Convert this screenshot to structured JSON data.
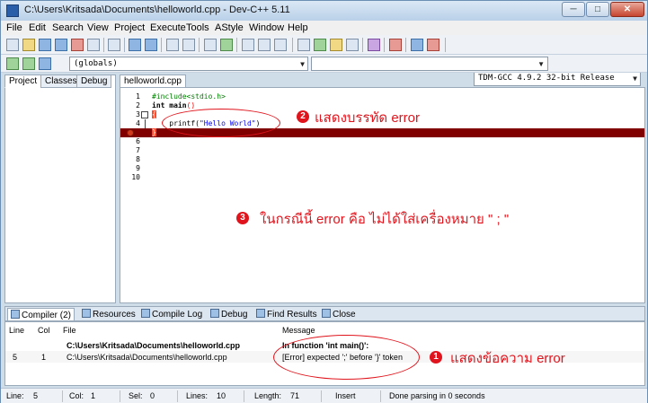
{
  "window": {
    "title": "C:\\Users\\Kritsada\\Documents\\helloworld.cpp - Dev-C++ 5.11",
    "minimize": "─",
    "maximize": "□",
    "close": "✕"
  },
  "menu": {
    "items": [
      "File",
      "Edit",
      "Search",
      "View",
      "Project",
      "Execute",
      "Tools",
      "AStyle",
      "Window",
      "Help"
    ]
  },
  "toolbar": {
    "compiler": "TDM-GCC 4.9.2 32-bit Release",
    "scope": "(globals)",
    "dropdown_arrow": "▼"
  },
  "left_panel": {
    "tabs": [
      "Project",
      "Classes",
      "Debug"
    ]
  },
  "editor": {
    "tab_label": "helloworld.cpp",
    "lines": [
      {
        "no": "1",
        "text": "#include<stdio.h>"
      },
      {
        "no": "2",
        "text": "int main()"
      },
      {
        "no": "3",
        "text": "{"
      },
      {
        "no": "4",
        "text": "    printf(\"Hello World\")"
      },
      {
        "no": "5",
        "text": "}"
      },
      {
        "no": "6",
        "text": ""
      },
      {
        "no": "7",
        "text": ""
      },
      {
        "no": "8",
        "text": ""
      },
      {
        "no": "9",
        "text": ""
      },
      {
        "no": "10",
        "text": ""
      }
    ],
    "line2_kw": "int",
    "line2_rest": " main",
    "line2_paren": "()",
    "line4_indent": "    printf(",
    "line4_str": "\"Hello World\"",
    "line4_close": ")",
    "fold_sign": "⊟",
    "error_line": "5"
  },
  "annotations": {
    "n1": "1",
    "n2": "2",
    "n3": "3",
    "text1": "แสดงข้อความ error",
    "text2": "แสดงบรรทัด error",
    "text3": "ในกรณีนี้ error คือ ไม่ได้ใส่เครื่องหมาย \" ; \""
  },
  "bottom_tabs": [
    {
      "label": "Compiler (2)"
    },
    {
      "label": "Resources"
    },
    {
      "label": "Compile Log"
    },
    {
      "label": "Debug"
    },
    {
      "label": "Find Results"
    },
    {
      "label": "Close"
    }
  ],
  "results": {
    "headers": {
      "line": "Line",
      "col": "Col",
      "file": "File",
      "message": "Message"
    },
    "rows": [
      {
        "line": "",
        "col": "",
        "file": "C:\\Users\\Kritsada\\Documents\\helloworld.cpp",
        "message": "In function 'int main()':"
      },
      {
        "line": "5",
        "col": "1",
        "file": "C:\\Users\\Kritsada\\Documents\\helloworld.cpp",
        "message": "[Error] expected ';' before '}' token"
      }
    ]
  },
  "status": {
    "line_label": "Line:",
    "line_val": "5",
    "col_label": "Col:",
    "col_val": "1",
    "sel_label": "Sel:",
    "sel_val": "0",
    "lines_label": "Lines:",
    "lines_val": "10",
    "length_label": "Length:",
    "length_val": "71",
    "mode": "Insert",
    "message": "Done parsing in 0 seconds"
  },
  "colors": {
    "error_line_bg": "#800000",
    "annotation_red": "#e0141c"
  }
}
